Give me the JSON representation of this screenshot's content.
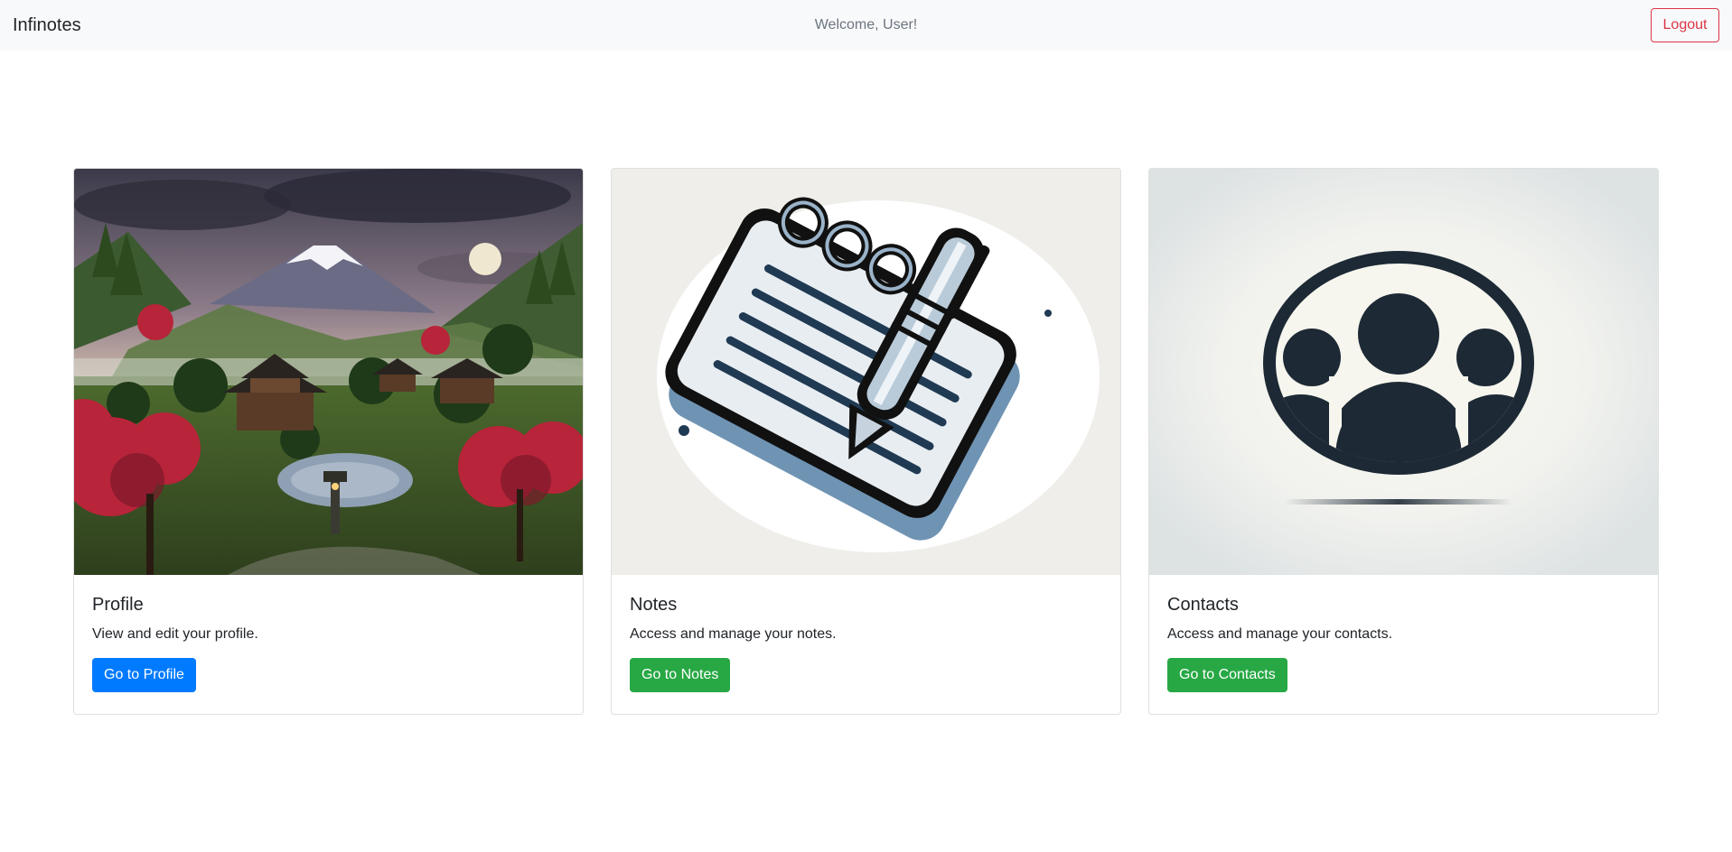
{
  "navbar": {
    "brand": "Infinotes",
    "welcome": "Welcome, User!",
    "logout_label": "Logout"
  },
  "cards": [
    {
      "title": "Profile",
      "text": "View and edit your profile.",
      "button_label": "Go to Profile",
      "image_icon": "japanese-landscape-image"
    },
    {
      "title": "Notes",
      "text": "Access and manage your notes.",
      "button_label": "Go to Notes",
      "image_icon": "notepad-pen-image"
    },
    {
      "title": "Contacts",
      "text": "Access and manage your contacts.",
      "button_label": "Go to Contacts",
      "image_icon": "contacts-group-image"
    }
  ],
  "colors": {
    "navbar_bg": "#f8f9fa",
    "logout": "#dc3545",
    "primary": "#007bff",
    "success": "#28a745"
  }
}
